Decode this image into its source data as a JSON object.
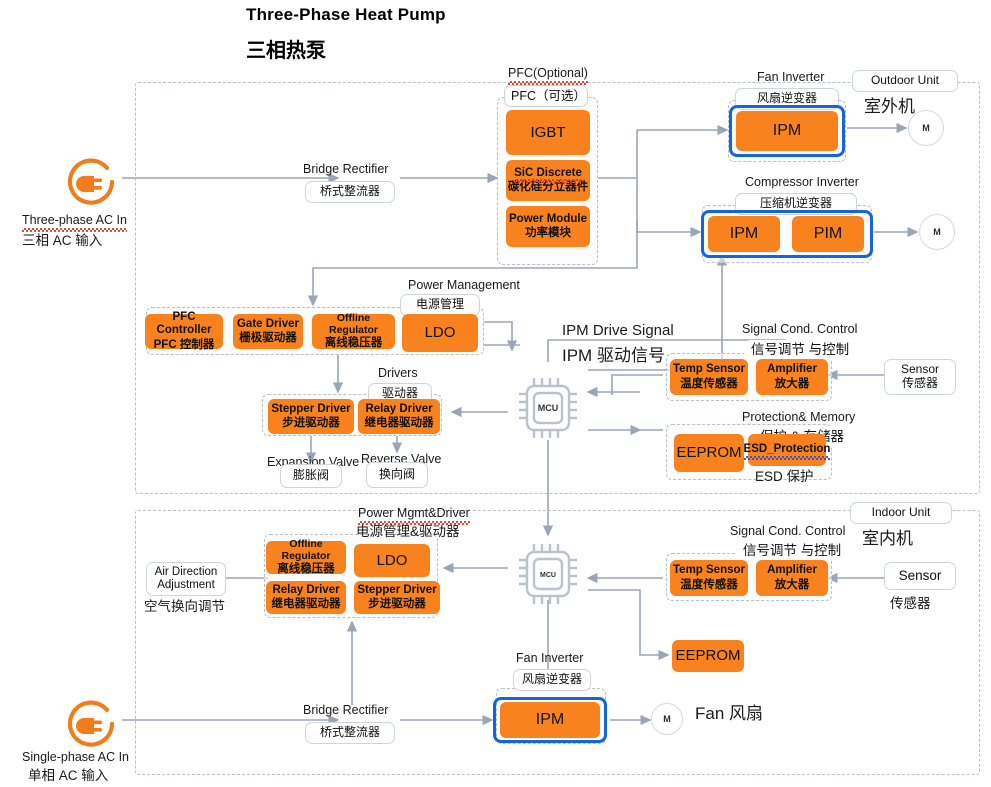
{
  "title": {
    "en": "Three-Phase Heat Pump",
    "cn": "三相热泵"
  },
  "colors": {
    "chip_orange": "#F8821E",
    "highlight_blue": "#1464E0",
    "line_gray": "#9aa6b5",
    "dashed_border": "#b9bec7"
  },
  "outdoor": {
    "boundary_label_en": "Outdoor Unit",
    "boundary_label_cn": "室外机",
    "ac_input": {
      "icon": "ac-plug-icon",
      "label_en": "Three-phase AC In",
      "label_cn": "三相 AC 输入"
    },
    "bridge_rectifier": {
      "label_en": "Bridge Rectifier",
      "label_cn": "桥式整流器"
    },
    "pfc": {
      "title_en": "PFC(Optional)",
      "title_cn": "PFC（可选）",
      "chips": [
        {
          "en": "IGBT",
          "cn": ""
        },
        {
          "en": "SiC Discrete",
          "cn": "碳化硅分立器件"
        },
        {
          "en": "Power Module",
          "cn": "功率模块"
        }
      ]
    },
    "fan_inverter": {
      "title_en": "Fan Inverter",
      "title_cn": "风扇逆变器",
      "chips": [
        {
          "en": "IPM",
          "cn": ""
        }
      ],
      "motor": "M"
    },
    "compressor_inverter": {
      "title_en": "Compressor Inverter",
      "title_cn": "压缩机逆变器",
      "chips": [
        {
          "en": "IPM",
          "cn": ""
        },
        {
          "en": "PIM",
          "cn": ""
        }
      ],
      "motor": "M"
    },
    "power_management": {
      "title_en": "Power Management",
      "title_cn": "电源管理",
      "chips": [
        {
          "en": "PFC Controller",
          "cn": "PFC 控制器"
        },
        {
          "en": "Gate Driver",
          "cn": "栅极驱动器"
        },
        {
          "en": "Offline Regulator",
          "cn": "离线稳压器"
        },
        {
          "en": "LDO",
          "cn": ""
        }
      ]
    },
    "drivers": {
      "title_en": "Drivers",
      "title_cn": "驱动器",
      "chips": [
        {
          "en": "Stepper Driver",
          "cn": "步进驱动器"
        },
        {
          "en": "Relay Driver",
          "cn": "继电器驱动器"
        }
      ]
    },
    "valves": [
      {
        "en": "Expansion Valve",
        "cn": "膨胀阀"
      },
      {
        "en": "Reverse Valve",
        "cn": "换向阀"
      }
    ],
    "mcu": {
      "label": "MCU",
      "drive_signal_en": "IPM Drive Signal",
      "drive_signal_cn": "IPM 驱动信号"
    },
    "signal_cond": {
      "title_en": "Signal Cond. Control",
      "title_cn": "信号调节 与控制",
      "chips": [
        {
          "en": "Temp Sensor",
          "cn": "温度传感器"
        },
        {
          "en": "Amplifier",
          "cn": "放大器"
        }
      ]
    },
    "sensor": {
      "label_en": "Sensor",
      "label_cn": "传感器"
    },
    "protection_memory": {
      "title_en": "Protection& Memory",
      "title_cn": "保护 & 存储器",
      "chips": [
        {
          "en": "EEPROM",
          "cn": ""
        },
        {
          "en": "ESD_Protection",
          "cn": "ESD 保护"
        }
      ]
    }
  },
  "indoor": {
    "boundary_label_en": "Indoor Unit",
    "boundary_label_cn": "室内机",
    "ac_input": {
      "icon": "ac-plug-icon",
      "label_en": "Single-phase AC In",
      "label_cn": "单相 AC 输入"
    },
    "bridge_rectifier": {
      "label_en": "Bridge Rectifier",
      "label_cn": "桥式整流器"
    },
    "power_mgmt_driver": {
      "title_en": "Power Mgmt&Driver",
      "title_cn": "电源管理&驱动器",
      "chips": [
        {
          "en": "Offline Regulator",
          "cn": "离线稳压器"
        },
        {
          "en": "LDO",
          "cn": ""
        },
        {
          "en": "Relay Driver",
          "cn": "继电器驱动器"
        },
        {
          "en": "Stepper Driver",
          "cn": "步进驱动器"
        }
      ]
    },
    "air_direction": {
      "label_en1": "Air Direction",
      "label_en2": "Adjustment",
      "label_cn": "空气换向调节"
    },
    "mcu": {
      "label": "MCU"
    },
    "signal_cond": {
      "title_en": "Signal Cond. Control",
      "title_cn": "信号调节 与控制",
      "chips": [
        {
          "en": "Temp Sensor",
          "cn": "温度传感器"
        },
        {
          "en": "Amplifier",
          "cn": "放大器"
        }
      ]
    },
    "sensor": {
      "label_en": "Sensor",
      "label_cn": "传感器"
    },
    "eeprom": {
      "en": "EEPROM",
      "cn": ""
    },
    "fan_inverter": {
      "title_en": "Fan Inverter",
      "title_cn": "风扇逆变器",
      "chips": [
        {
          "en": "IPM",
          "cn": ""
        }
      ],
      "motor": "M",
      "fan_label": "Fan 风扇"
    }
  }
}
